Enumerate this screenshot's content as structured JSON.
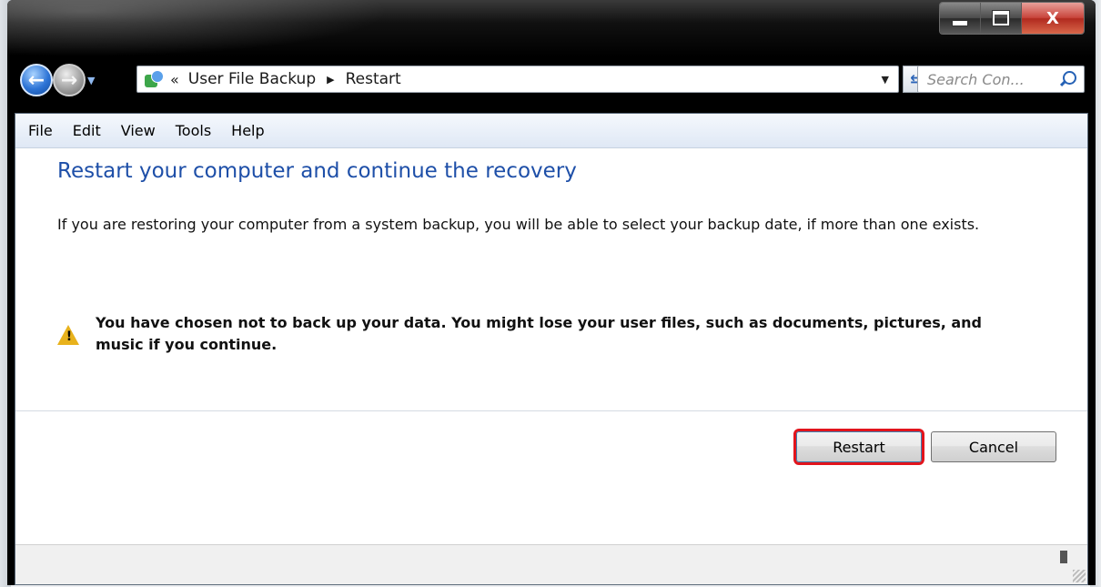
{
  "window": {
    "controls": {
      "minimize_icon": "minimize-icon",
      "maximize_icon": "maximize-icon",
      "close_label": "X"
    }
  },
  "navigation": {
    "back_icon": "back-arrow-icon",
    "forward_icon": "forward-arrow-icon",
    "address_chevron": "«",
    "breadcrumbs": [
      "User File Backup",
      "Restart"
    ],
    "separator": "▶",
    "search_placeholder": "Search Con..."
  },
  "menu": {
    "items": [
      "File",
      "Edit",
      "View",
      "Tools",
      "Help"
    ]
  },
  "content": {
    "heading": "Restart your computer and continue the recovery",
    "description": "If you are restoring your computer from a system backup, you will be able to select your backup date, if more than one exists.",
    "warning_text": "You have chosen not to back up your data. You might lose your user files, such as documents, pictures, and music if you continue.",
    "warning_glyph": "!"
  },
  "buttons": {
    "restart_label": "Restart",
    "cancel_label": "Cancel"
  },
  "colors": {
    "heading": "#1e4fa8",
    "highlight": "#e2141c",
    "warning": "#e8b21c"
  }
}
